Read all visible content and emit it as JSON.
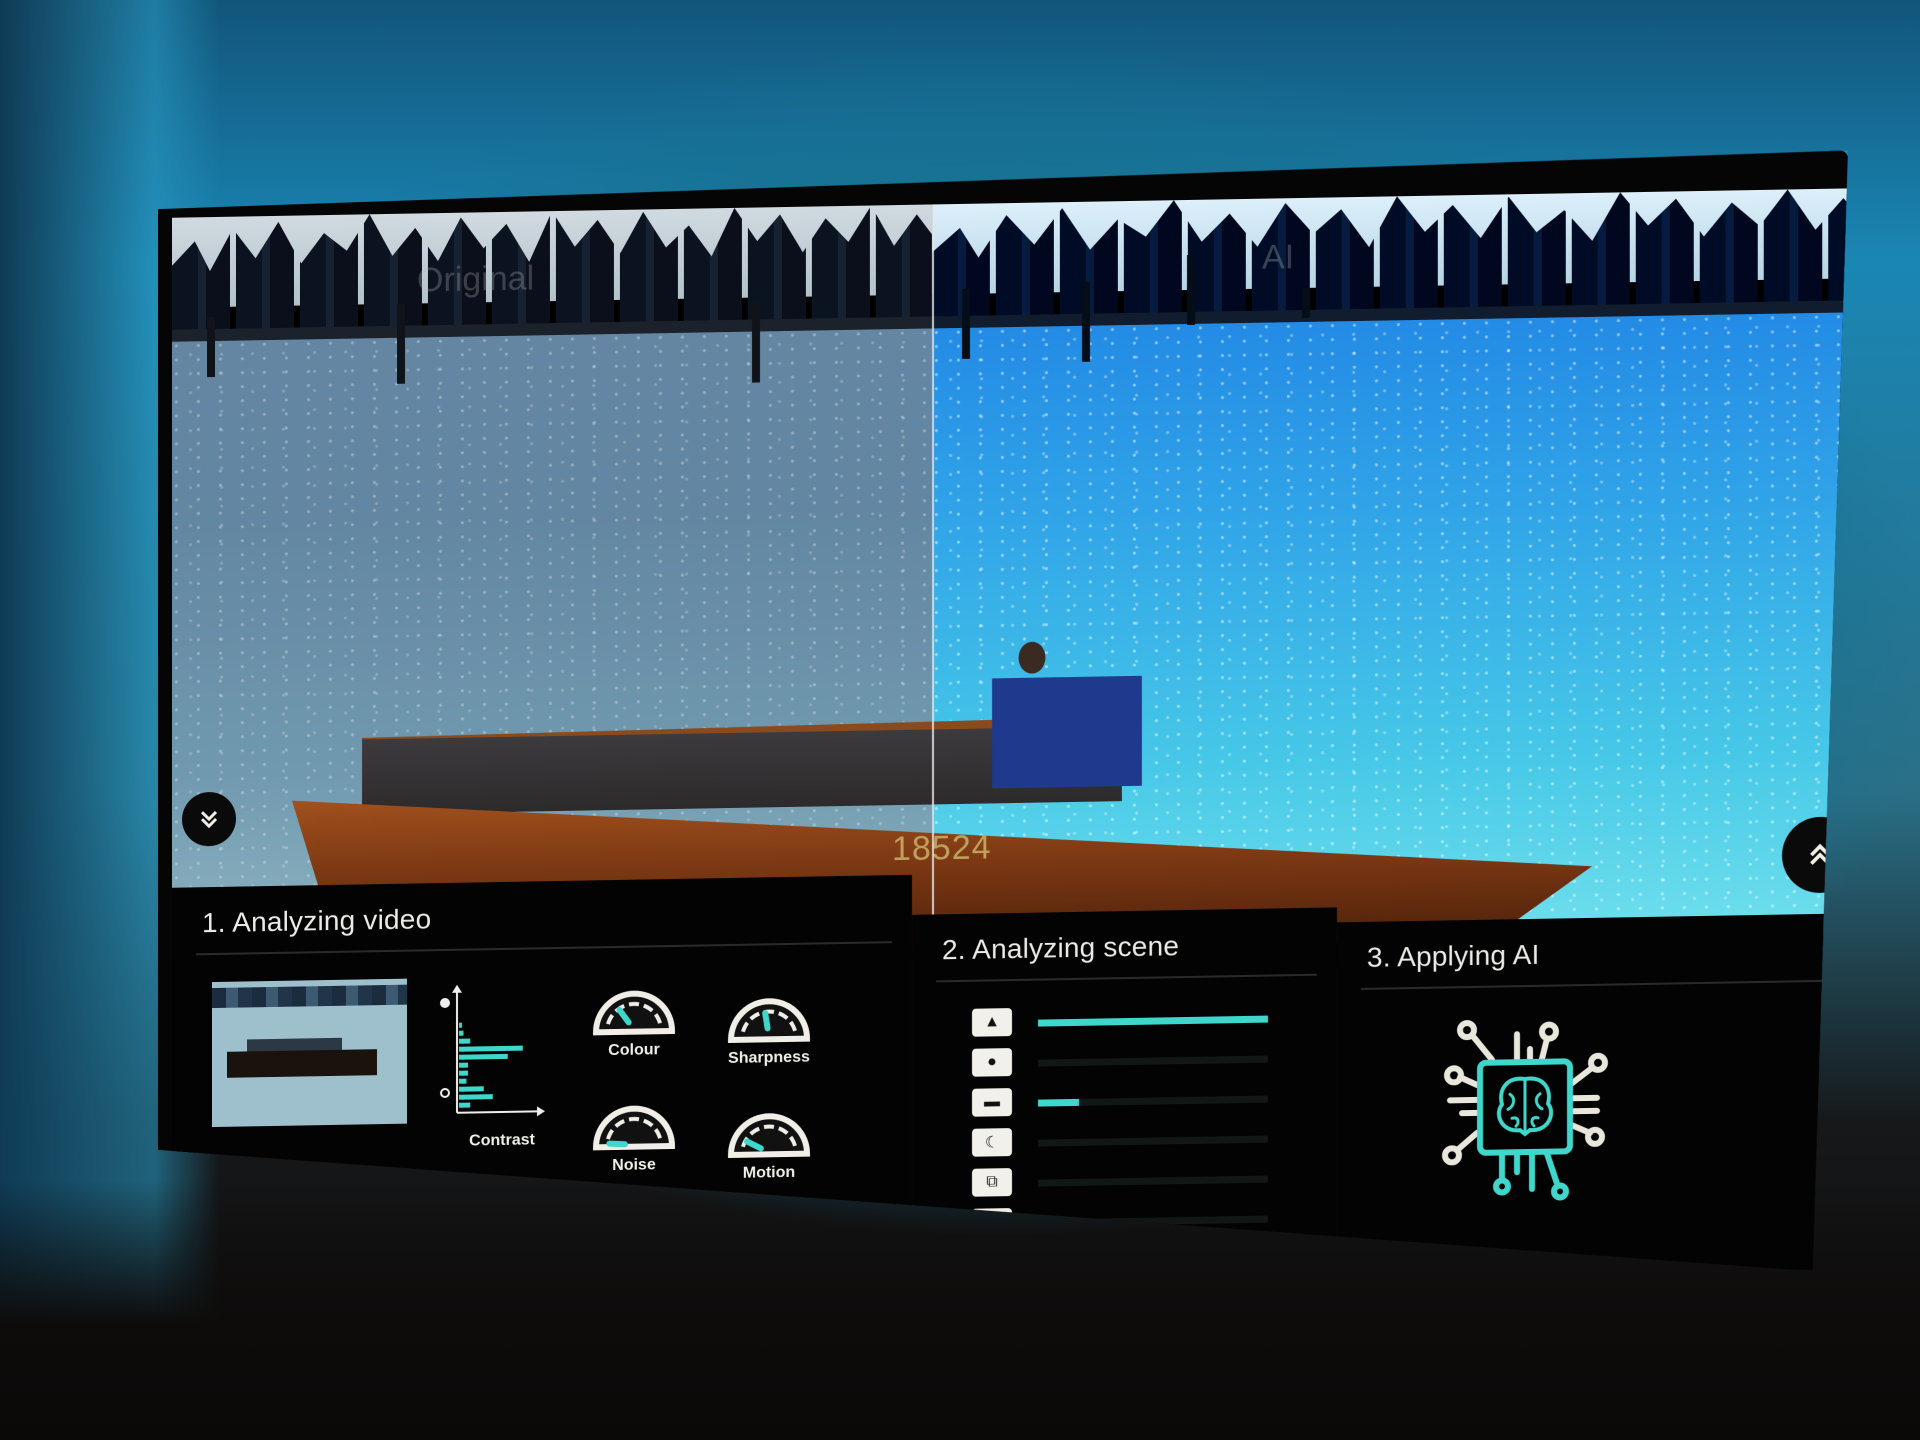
{
  "video": {
    "left_label": "Original",
    "right_label": "AI",
    "boat_number": "18524",
    "collapse_button_icon": "double-chevron-down-icon",
    "expand_button_icon": "double-chevron-up-icon"
  },
  "colors": {
    "accent": "#3fd7cc",
    "text": "#ecebe6",
    "panel_bg": "#030303"
  },
  "sections": {
    "analyzing_video": {
      "title": "1. Analyzing video",
      "histogram": {
        "axis_label": "Contrast",
        "top_icon": "bright-sun-icon",
        "bottom_icon": "dim-sun-icon",
        "bars": [
          0.02,
          0.06,
          0.15,
          0.85,
          0.65,
          0.12,
          0.12,
          0.1,
          0.33,
          0.45,
          0.15
        ]
      },
      "gauges": [
        {
          "label": "Colour",
          "level": 0.3
        },
        {
          "label": "Sharpness",
          "level": 0.45
        },
        {
          "label": "Noise",
          "level": 0.02
        },
        {
          "label": "Motion",
          "level": 0.15
        }
      ]
    },
    "analyzing_scene": {
      "title": "2. Analyzing scene",
      "categories": [
        {
          "icon": "landscape-icon",
          "glyph": "▲",
          "confidence": 1.0
        },
        {
          "icon": "person-icon",
          "glyph": "●",
          "confidence": 0.0
        },
        {
          "icon": "car-icon",
          "glyph": "▬",
          "confidence": 0.18
        },
        {
          "icon": "night-moon-icon",
          "glyph": "☾",
          "confidence": 0.0
        },
        {
          "icon": "overlap-squares-icon",
          "glyph": "⧉",
          "confidence": 0.0
        },
        {
          "icon": "more-icon",
          "glyph": "•••",
          "confidence": 0.01
        }
      ]
    },
    "applying_ai": {
      "title": "3. Applying AI",
      "icon": "ai-brain-chip-icon"
    }
  }
}
